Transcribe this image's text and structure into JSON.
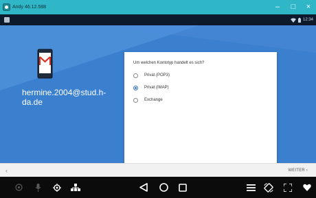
{
  "window": {
    "title": "Andy 46.12.588",
    "minimize": "–",
    "maximize": "□",
    "close": "×"
  },
  "status": {
    "time": "12:34"
  },
  "account": {
    "email": "hermine.2004@stud.h-da.de"
  },
  "dialog": {
    "question": "Um welchen Kontotyp handelt es sich?",
    "options": [
      {
        "label": "Privat (POP3)",
        "selected": false
      },
      {
        "label": "Privat (IMAP)",
        "selected": true
      },
      {
        "label": "Exchange",
        "selected": false
      }
    ]
  },
  "footer": {
    "back": "‹",
    "next": "WEITER ›"
  },
  "colors": {
    "titlebar": "#2fb6c7",
    "background": "#3b7fcf",
    "accent": "#3b74c8",
    "gmail_red": "#d93025"
  }
}
